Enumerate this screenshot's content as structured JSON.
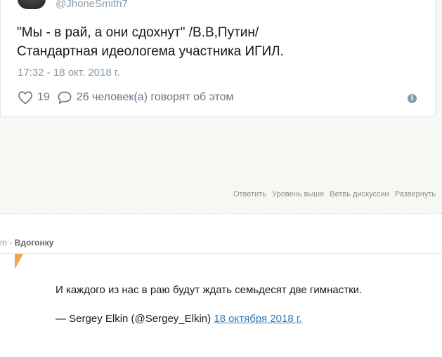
{
  "tweet": {
    "handle": "@JhoneSmith7",
    "text_line1": "\"Мы - в рай, а они сдохнут\" /В.В,Путин/",
    "text_line2": "Стандартная идеологема участника ИГИЛ.",
    "timestamp": "17:32 - 18 окт. 2018 г.",
    "likes_count": "19",
    "replies_label": "26 человек(а) говорят об этом",
    "info_icon": "i"
  },
  "comment_actions": {
    "reply": "Ответить",
    "parent": "Уровень выше",
    "thread": "Ветвь дискуссии",
    "expand": "Развернуть"
  },
  "next_comment": {
    "header_prefix": "m - ",
    "subject": "Вдогонку",
    "quote": "И каждого из нас в раю будут ждать семьдесят две гимнастки.",
    "attribution": "— Sergey Elkin (@Sergey_Elkin)",
    "date_link": "18 октября 2018 г."
  },
  "colors": {
    "link": "#2b7bb9",
    "muted": "#8899a6",
    "flag": "#f5a14d"
  }
}
